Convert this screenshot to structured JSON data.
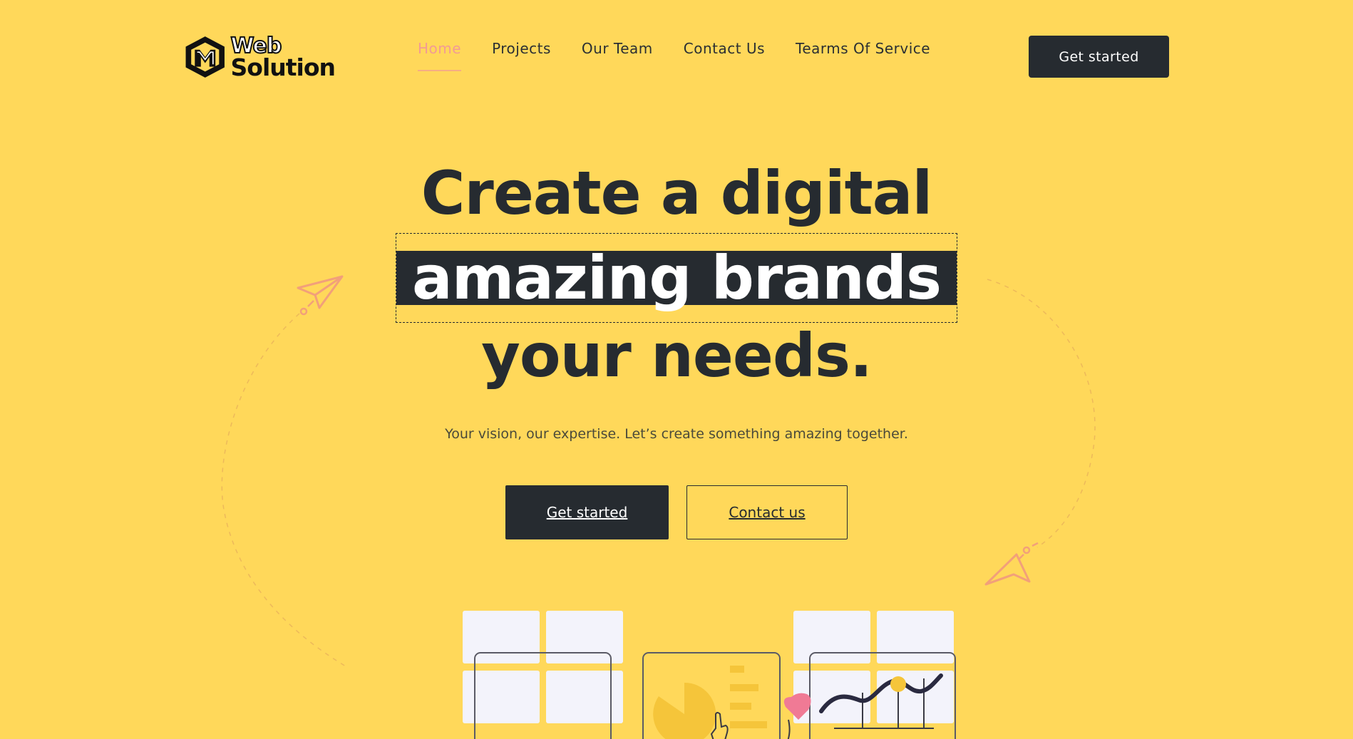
{
  "logo": {
    "line1": "Web",
    "line2": "Solution"
  },
  "nav": {
    "items": [
      {
        "label": "Home",
        "active": true
      },
      {
        "label": "Projects",
        "active": false
      },
      {
        "label": "Our Team",
        "active": false
      },
      {
        "label": "Contact Us",
        "active": false
      },
      {
        "label": "Tearms Of Service",
        "active": false
      }
    ],
    "cta_label": "Get started"
  },
  "hero": {
    "title_line1": "Create a digital",
    "title_highlight": "amazing brands",
    "title_line3": "your needs.",
    "subtitle": "Your vision, our expertise. Let’s create something amazing together.",
    "primary_button": "Get started",
    "secondary_button": "Contact us"
  },
  "colors": {
    "background": "#ffd85a",
    "dark": "#262b30",
    "accent": "#f29b95",
    "plane": "#f2a07a"
  },
  "icons": [
    "logo-hexagon-icon",
    "paper-plane-icon",
    "pie-chart-icon",
    "line-chart-icon",
    "hand-pointer-icon"
  ]
}
